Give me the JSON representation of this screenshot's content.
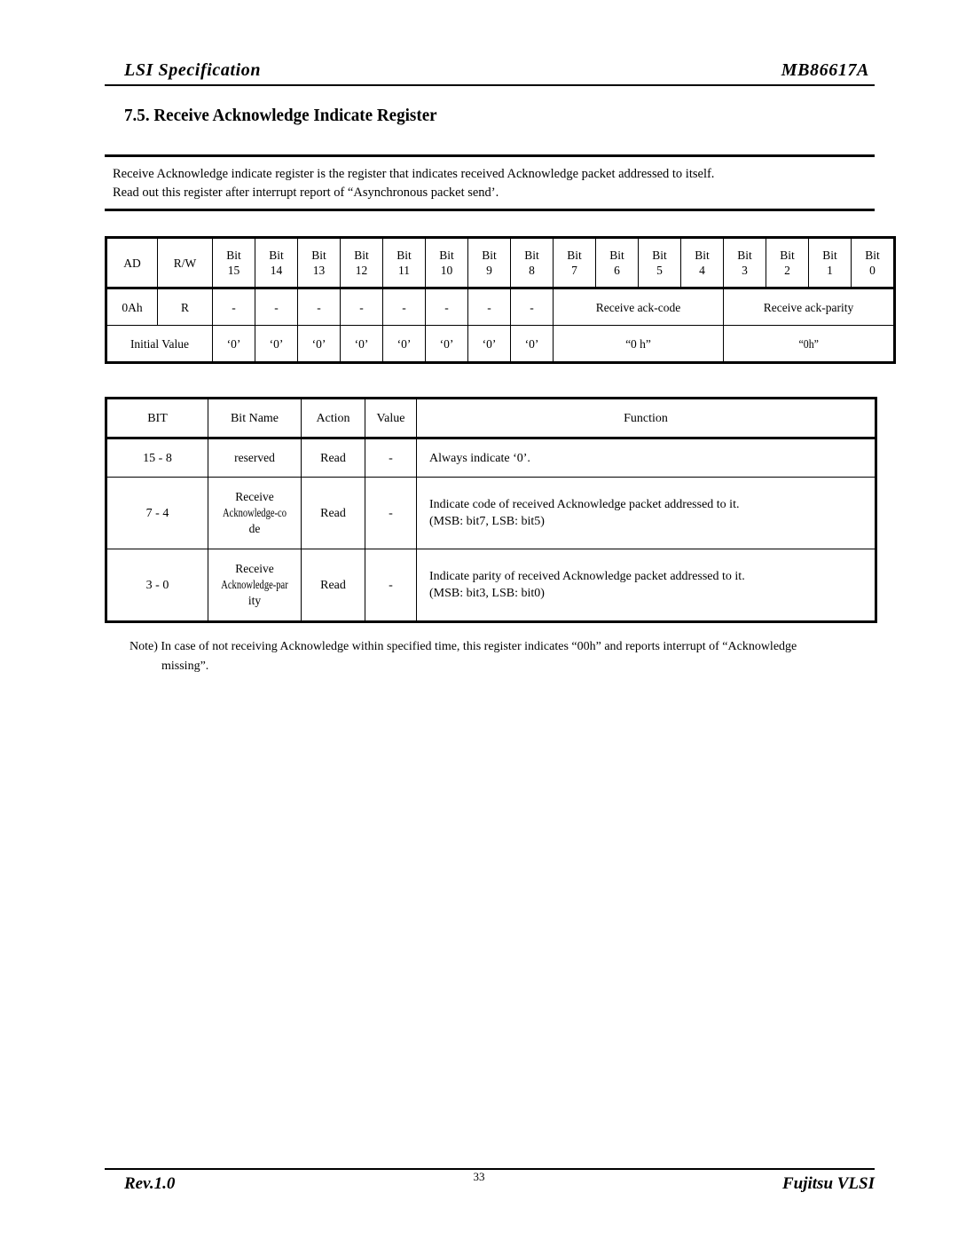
{
  "header": {
    "left_title": "LSI Specification",
    "right_title": "MB86617A"
  },
  "section": {
    "title": "7.5. Receive Acknowledge Indicate Register"
  },
  "description": {
    "line1": "Receive Acknowledge indicate register is the register that indicates received Acknowledge packet addressed to itself.",
    "line2": "Read out this register after interrupt report of “Asynchronous packet send’."
  },
  "register_table": {
    "header": {
      "ad": "AD",
      "rw": "R/W",
      "bits": [
        {
          "label": "Bit",
          "number": "15"
        },
        {
          "label": "Bit",
          "number": "14"
        },
        {
          "label": "Bit",
          "number": "13"
        },
        {
          "label": "Bit",
          "number": "12"
        },
        {
          "label": "Bit",
          "number": "11"
        },
        {
          "label": "Bit",
          "number": "10"
        },
        {
          "label": "Bit",
          "number": "9"
        },
        {
          "label": "Bit",
          "number": "8"
        },
        {
          "label": "Bit",
          "number": "7"
        },
        {
          "label": "Bit",
          "number": "6"
        },
        {
          "label": "Bit",
          "number": "5"
        },
        {
          "label": "Bit",
          "number": "4"
        },
        {
          "label": "Bit",
          "number": "3"
        },
        {
          "label": "Bit",
          "number": "2"
        },
        {
          "label": "Bit",
          "number": "1"
        },
        {
          "label": "Bit",
          "number": "0"
        }
      ]
    },
    "body": {
      "ad_value": "0Ah",
      "rw_value": "R",
      "bit_values": [
        "-",
        "-",
        "-",
        "-",
        "-",
        "-",
        "-",
        "-"
      ],
      "field_ack_code": "Receive ack-code",
      "field_ack_parity": "Receive ack-parity"
    },
    "initial": {
      "label": "Initial Value",
      "bit_values": [
        "‘0’",
        "‘0’",
        "‘0’",
        "‘0’",
        "‘0’",
        "‘0’",
        "‘0’",
        "‘0’"
      ],
      "ack_code_value": "“0 h”",
      "ack_parity_value": "“0h”"
    }
  },
  "bit_table": {
    "headers": {
      "bit": "BIT",
      "bit_name": "Bit Name",
      "action": "Action",
      "value": "Value",
      "function": "Function"
    },
    "rows": [
      {
        "bit": "15 - 8",
        "name_line1": "reserved",
        "name_line2": "",
        "name_line3": "",
        "action": "Read",
        "value": "-",
        "function_line1": "Always indicate ‘0’.",
        "function_line2": ""
      },
      {
        "bit": "7 - 4",
        "name_line1": "Receive",
        "name_line2": "Acknowledge-co",
        "name_line3": "de",
        "action": "Read",
        "value": "-",
        "function_line1": "Indicate code of received Acknowledge packet addressed to it.",
        "function_line2": "(MSB: bit7, LSB: bit5)"
      },
      {
        "bit": "3 - 0",
        "name_line1": "Receive",
        "name_line2": "Acknowledge-par",
        "name_line3": "ity",
        "action": "Read",
        "value": "-",
        "function_line1": "Indicate parity of received  Acknowledge packet addressed to it.",
        "function_line2": "(MSB: bit3, LSB: bit0)"
      }
    ]
  },
  "note": {
    "line1": "Note) In case of not receiving Acknowledge within specified time, this register indicates  “00h” and reports interrupt of “Acknowledge",
    "line2": "missing”."
  },
  "footer": {
    "revision": "Rev.1.0",
    "page_number": "33",
    "company": "Fujitsu VLSI"
  }
}
